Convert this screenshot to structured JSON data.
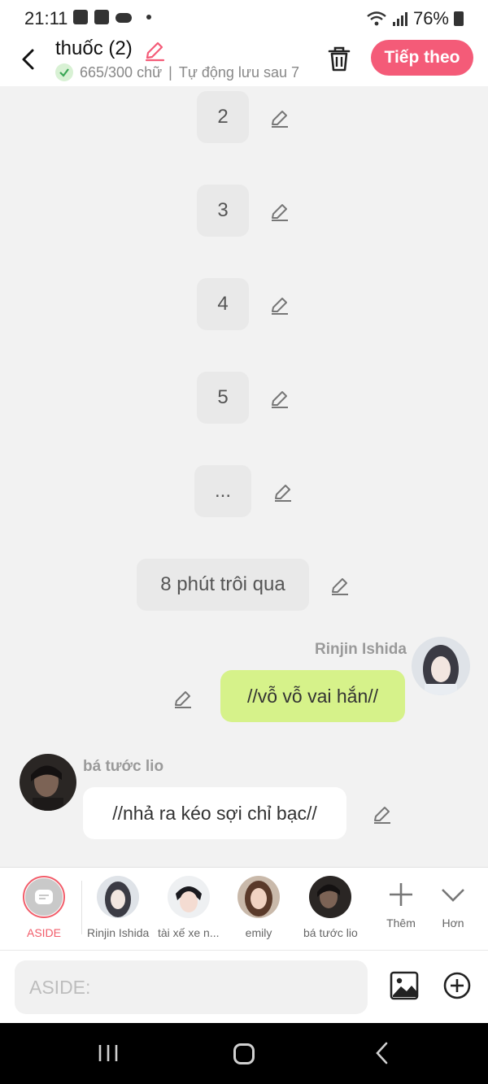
{
  "status_bar": {
    "time": "21:11",
    "battery": "76%"
  },
  "header": {
    "title": "thuốc (2)",
    "word_count": "665/300 chữ",
    "autosave": "Tự động lưu sau 7",
    "next_label": "Tiếp theo"
  },
  "chips": [
    "2",
    "3",
    "4",
    "5",
    "...",
    "8 phút trôi qua"
  ],
  "messages": [
    {
      "speaker": "Rinjin Ishida",
      "text": "//vỗ vỗ vai hắn//",
      "side": "right",
      "bubble_color": "#d6f28a"
    },
    {
      "speaker": "bá tước lio",
      "text": "//nhả ra kéo sợi chỉ bạc//",
      "side": "left",
      "bubble_color": "#ffffff"
    }
  ],
  "character_bar": {
    "aside_label": "ASIDE",
    "characters": [
      "Rinjin Ishida",
      "tài xế xe n...",
      "emily",
      "bá tước lio"
    ],
    "add_label": "Thêm",
    "more_label": "Hơn"
  },
  "composer": {
    "placeholder": "ASIDE:"
  },
  "colors": {
    "accent": "#f45b78",
    "aside_red": "#f25d6a",
    "my_bubble": "#d6f28a"
  },
  "icons": [
    "back-arrow-icon",
    "pencil-icon",
    "check-icon",
    "trash-icon",
    "image-icon",
    "plus-circle-icon",
    "chevron-down-icon",
    "plus-icon"
  ]
}
